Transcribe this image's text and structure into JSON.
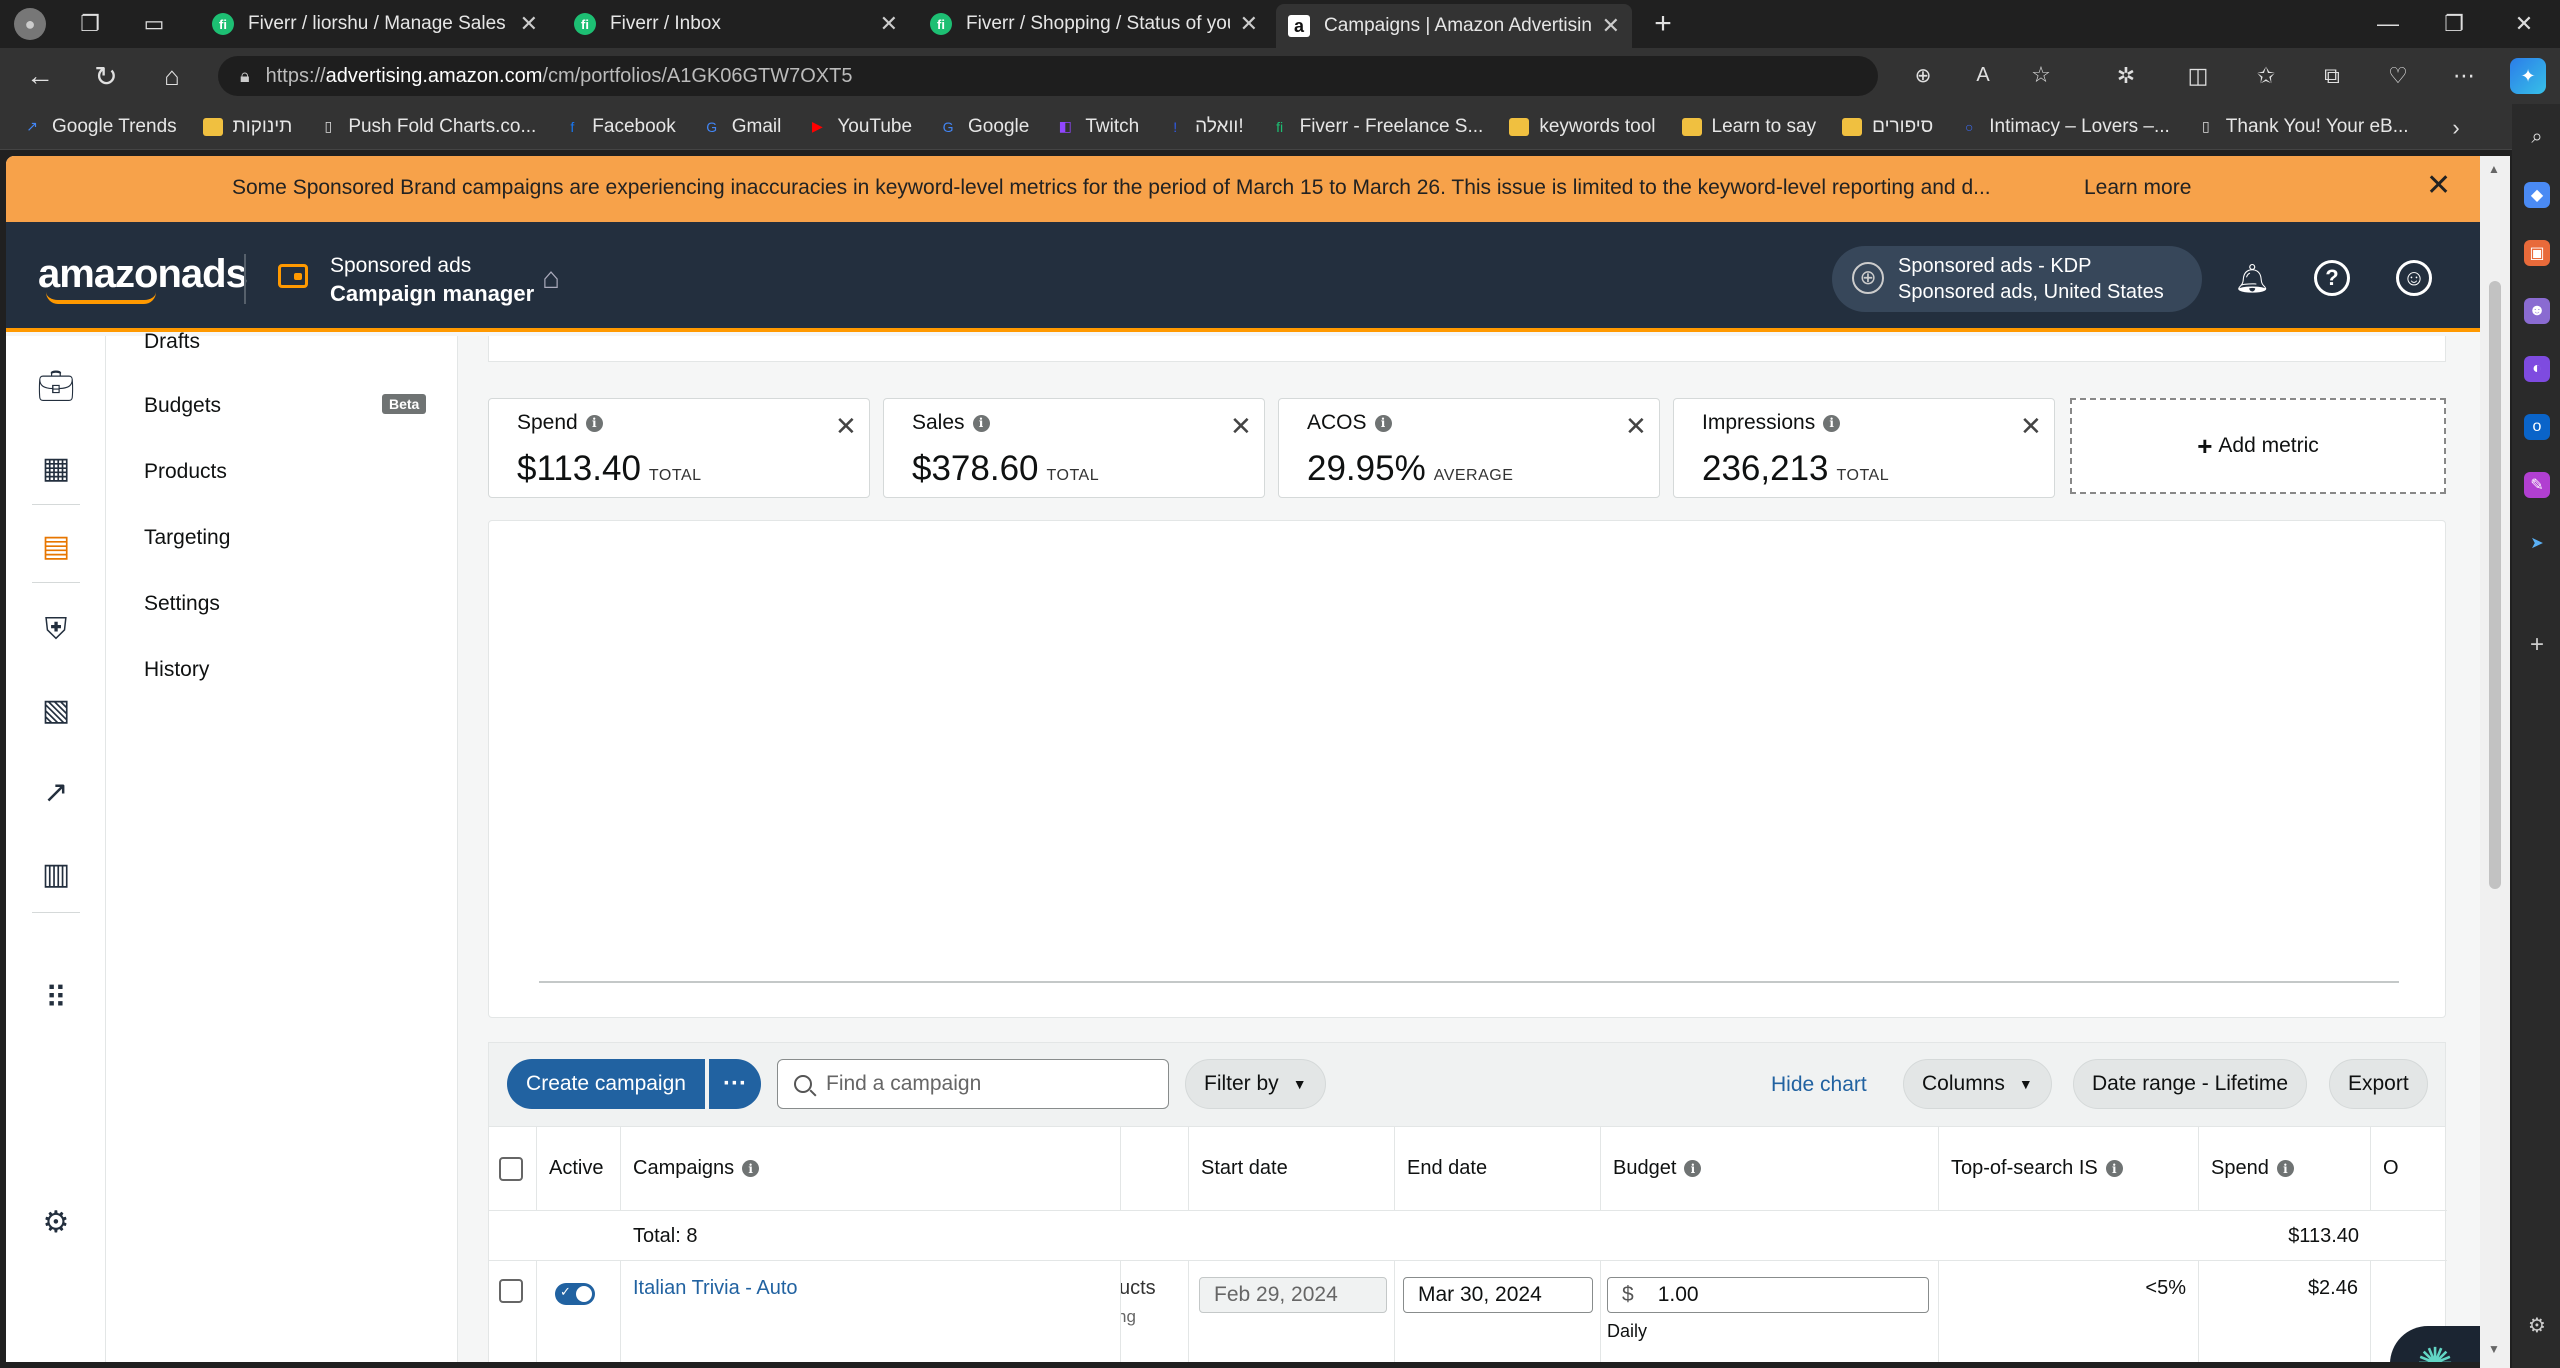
{
  "browser": {
    "tabs": [
      {
        "title": "Fiverr / liorshu / Manage Sales",
        "favicon": "fi"
      },
      {
        "title": "Fiverr / Inbox",
        "favicon": "fi"
      },
      {
        "title": "Fiverr / Shopping / Status of your",
        "favicon": "fi"
      },
      {
        "title": "Campaigns | Amazon Advertising",
        "favicon": "a"
      }
    ],
    "url_prefix": "https://",
    "url_domain": "advertising.amazon.com",
    "url_path": "/cm/portfolios/A1GK06GTW7OXT5",
    "bookmarks": [
      {
        "label": "Google Trends",
        "icon": "trends-icon",
        "color": "#4285f4"
      },
      {
        "label": "תינוקות",
        "icon": "folder-icon",
        "color": "#f0c040"
      },
      {
        "label": "Push Fold Charts.co...",
        "icon": "page-icon",
        "color": "#ddd"
      },
      {
        "label": "Facebook",
        "icon": "facebook-icon",
        "color": "#1877f2"
      },
      {
        "label": "Gmail",
        "icon": "google-icon",
        "color": "#fff"
      },
      {
        "label": "YouTube",
        "icon": "youtube-icon",
        "color": "#ff0000"
      },
      {
        "label": "Google",
        "icon": "google-icon",
        "color": "#fff"
      },
      {
        "label": "Twitch",
        "icon": "twitch-icon",
        "color": "#9146ff"
      },
      {
        "label": "וואלה!",
        "icon": "walla-icon",
        "color": "#2f5bea"
      },
      {
        "label": "Fiverr - Freelance S...",
        "icon": "fiverr-icon",
        "color": "#1dbf73"
      },
      {
        "label": "keywords tool",
        "icon": "folder-icon",
        "color": "#f0c040"
      },
      {
        "label": "Learn to say",
        "icon": "folder-icon",
        "color": "#f0c040"
      },
      {
        "label": "סיפורים",
        "icon": "folder-icon",
        "color": "#f0c040"
      },
      {
        "label": "Intimacy – Lovers –...",
        "icon": "circle-icon",
        "color": "#3b6cf6"
      },
      {
        "label": "Thank You! Your eB...",
        "icon": "page-icon",
        "color": "#ddd"
      }
    ]
  },
  "notice": {
    "message": "Some Sponsored Brand campaigns are experiencing inaccuracies in keyword-level metrics for the period of March 15 to March 26. This issue is limited to the keyword-level reporting and d...",
    "learn_more": "Learn more"
  },
  "header": {
    "logo": "amazonads",
    "product_line1": "Sponsored ads",
    "product_line2": "Campaign manager",
    "account_line1": "Sponsored ads - KDP",
    "account_line2": "Sponsored ads, United States"
  },
  "subnav": {
    "items": [
      "Drafts",
      "Budgets",
      "Products",
      "Targeting",
      "Settings",
      "History"
    ],
    "beta_badge": "Beta"
  },
  "metrics": [
    {
      "name": "Spend",
      "value": "$113.40",
      "label": "TOTAL"
    },
    {
      "name": "Sales",
      "value": "$378.60",
      "label": "TOTAL"
    },
    {
      "name": "ACOS",
      "value": "29.95%",
      "label": "AVERAGE"
    },
    {
      "name": "Impressions",
      "value": "236,213",
      "label": "TOTAL"
    }
  ],
  "add_metric": "Add metric",
  "toolbar": {
    "create_campaign": "Create campaign",
    "more": "···",
    "search_placeholder": "Find a campaign",
    "filter_by": "Filter by",
    "hide_chart": "Hide chart",
    "columns": "Columns",
    "date_range": "Date range - Lifetime",
    "export": "Export"
  },
  "table": {
    "headers": {
      "active": "Active",
      "campaigns": "Campaigns",
      "start_date": "Start date",
      "end_date": "End date",
      "budget": "Budget",
      "top_of_search": "Top-of-search IS",
      "spend": "Spend",
      "next": "O"
    },
    "total_label": "Total: 8",
    "total_spend": "$113.40",
    "rows": [
      {
        "campaign": "Italian Trivia - Auto",
        "partial_col_line1": "ucts",
        "partial_col_line2": "ng",
        "start_date": "Feb 29, 2024",
        "end_date": "Mar 30, 2024",
        "budget_currency": "$",
        "budget": "1.00",
        "budget_type": "Daily",
        "top_of_search": "<5%",
        "spend": "$2.46"
      }
    ]
  }
}
